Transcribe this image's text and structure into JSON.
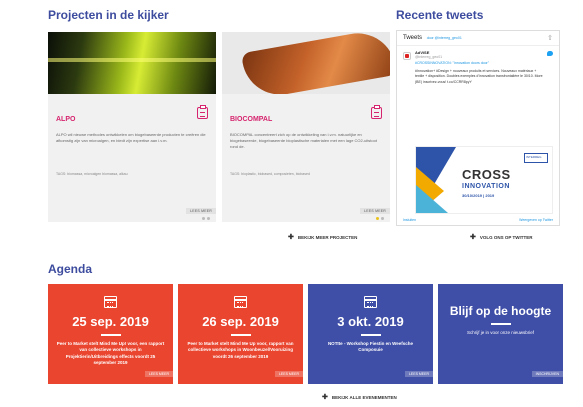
{
  "projects_section": {
    "title": "Projecten in de kijker",
    "cards": [
      {
        "name": "ALPO",
        "description": "ALPO wil nieuwe methodes ontwikkelen om biogebaseerde producten te creëren die afkomstig zijn van microalgen, en biedt zijn expertise aan i.v.m.",
        "tags": "TAGS: biomassa, microalgen biomassa, alkau",
        "read_more": "LEES MEER"
      },
      {
        "name": "BIOCOMPAL",
        "description": "BIOCOMPAL concentreert zich op de ontwikkeling van i.v.m. natuurlijke en biogebaseerde, biogebaseerde bioplastische materialen met een lage CO2-uitstoot rond de.",
        "tags": "TAGS: bioplastic, biobased, composieten, biobased",
        "read_more": "LEES MEER"
      }
    ],
    "see_more": "BEKIJK MEER PROJECTEN"
  },
  "tweets_section": {
    "title": "Recente tweets",
    "widget_header": "Tweets",
    "widget_handle": "door @interreg_geo01",
    "tweet": {
      "author": "AdViSE",
      "handle": "@interreg_geo01",
      "lines": [
        "#CROSSINNOVATION: \"Innovation doors door\"",
        "#Innovation+ #Design + nouveaux produits et services. Nouveaux matériaux + textile + disposition. Doubles exemples d'innovation transfrontalière le 30/10. More (BE) inscrivez-vous! t.co/CCRR8pyY"
      ]
    },
    "image": {
      "word1": "CROSS",
      "word2": "INNOVATION",
      "date": "30/10/2019 | 2019",
      "logo": "INTERREG"
    },
    "footer_left": "Insluiten",
    "footer_right": "Weergeven op Twitter",
    "follow": "VOLG ONS OP TWITTER"
  },
  "agenda_section": {
    "title": "Agenda",
    "events": [
      {
        "date": "25 sep. 2019",
        "text": "Peer to Market stelt Mind Me Up! voor, een rapport van collectieve workshops in Projektierin/Uitbreidings effects voordt 25 september 2019",
        "read_more": "LEES MEER"
      },
      {
        "date": "26 sep. 2019",
        "text": "Peer to Market stelt Mind Me Up voor, rapport van collectieve workshops in Woonbeuzel/Vooruizing voordt 26 september 2019",
        "read_more": "LEES MEER"
      },
      {
        "date": "3 okt. 2019",
        "text": "NOTIte - Workshop Fiestin en Weefsche Composuie",
        "read_more": "LEES MEER"
      }
    ],
    "stay_updated": {
      "title": "Blijf op de hoogte",
      "subtitle": "Schrijf je in voor onze nieuwsbrief",
      "read_more": "INSCHRIJVEN"
    },
    "see_all": "BEKIJK ALLE EVENEMENTEN"
  }
}
